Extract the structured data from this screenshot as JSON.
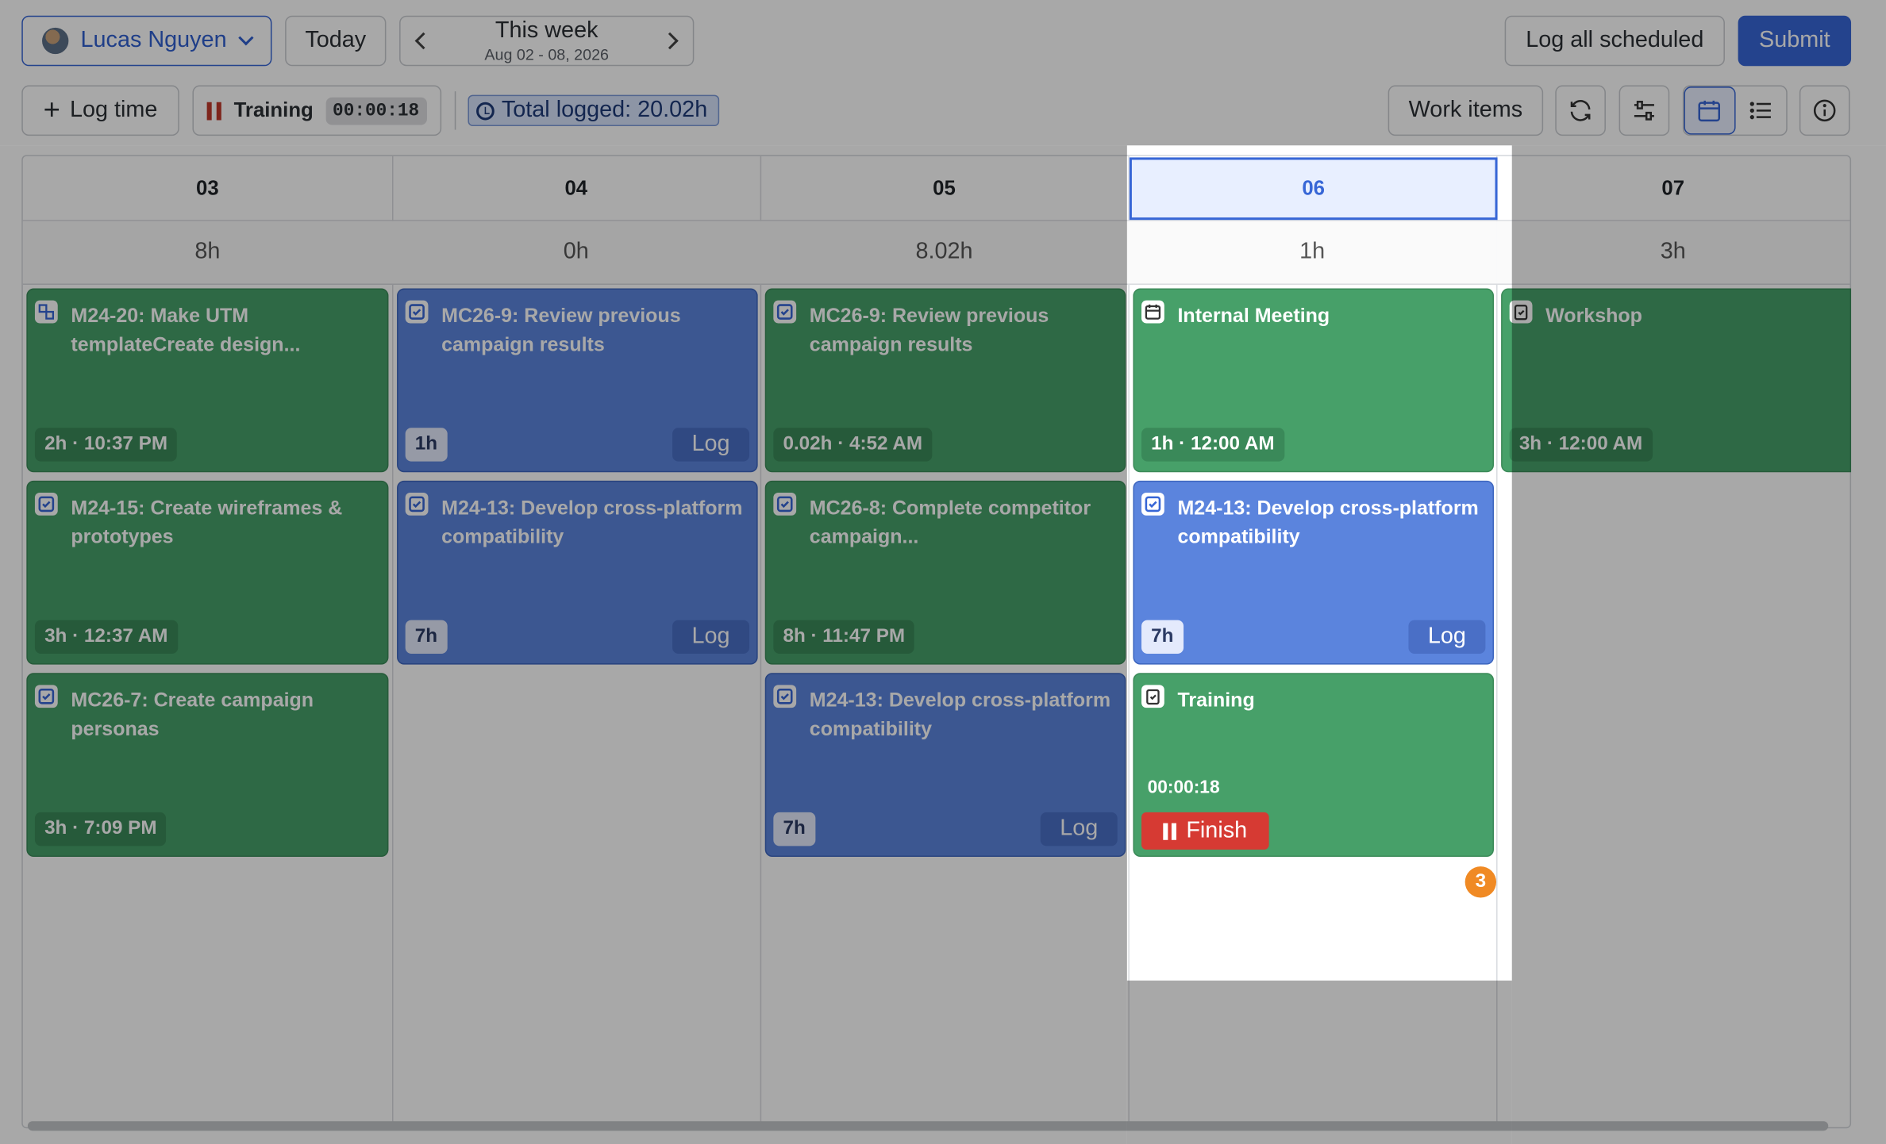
{
  "header": {
    "user_name": "Lucas Nguyen",
    "today_label": "Today",
    "week_title": "This week",
    "week_range": "Aug 02 - 08, 2026",
    "log_all_label": "Log all scheduled",
    "submit_label": "Submit"
  },
  "toolbar": {
    "log_time_label": "Log time",
    "timer_label": "Training",
    "timer_time": "00:00:18",
    "total_logged": "Total logged: 20.02h",
    "work_items_label": "Work items"
  },
  "days": [
    {
      "date": "03",
      "total": "8h"
    },
    {
      "date": "04",
      "total": "0h"
    },
    {
      "date": "05",
      "total": "8.02h"
    },
    {
      "date": "06",
      "total": "1h"
    },
    {
      "date": "07",
      "total": "3h"
    }
  ],
  "entries": {
    "d03_1": {
      "title": "M24-20: Make UTM templateCreate design...",
      "meta": "2h · 10:37 PM"
    },
    "d03_2": {
      "title": "M24-15: Create wireframes & prototypes",
      "meta": "3h · 12:37 AM"
    },
    "d03_3": {
      "title": "MC26-7: Create campaign personas",
      "meta": "3h · 7:09 PM"
    },
    "d04_1": {
      "title": "MC26-9: Review previous campaign results",
      "meta": "1h",
      "action": "Log"
    },
    "d04_2": {
      "title": "M24-13: Develop cross-platform compatibility",
      "meta": "7h",
      "action": "Log"
    },
    "d05_1": {
      "title": "MC26-9: Review previous campaign results",
      "meta": "0.02h · 4:52 AM"
    },
    "d05_2": {
      "title": "MC26-8: Complete competitor campaign...",
      "meta": "8h · 11:47 PM"
    },
    "d05_3": {
      "title": "M24-13: Develop cross-platform compatibility",
      "meta": "7h",
      "action": "Log"
    },
    "d06_1": {
      "title": "Internal Meeting",
      "meta": "1h · 12:00 AM"
    },
    "d06_2": {
      "title": "M24-13: Develop cross-platform compatibility",
      "meta": "7h",
      "action": "Log"
    },
    "d06_3": {
      "title": "Training",
      "elapsed": "00:00:18",
      "action": "Finish"
    },
    "d07_1": {
      "title": "Workshop",
      "meta": "3h · 12:00 AM"
    }
  },
  "overflow_badge": "3",
  "colors": {
    "accent": "#3766d6",
    "green_card": "#47a069",
    "blue_card": "#5b84dd",
    "finish": "#d63a33",
    "badge": "#f08a24"
  }
}
